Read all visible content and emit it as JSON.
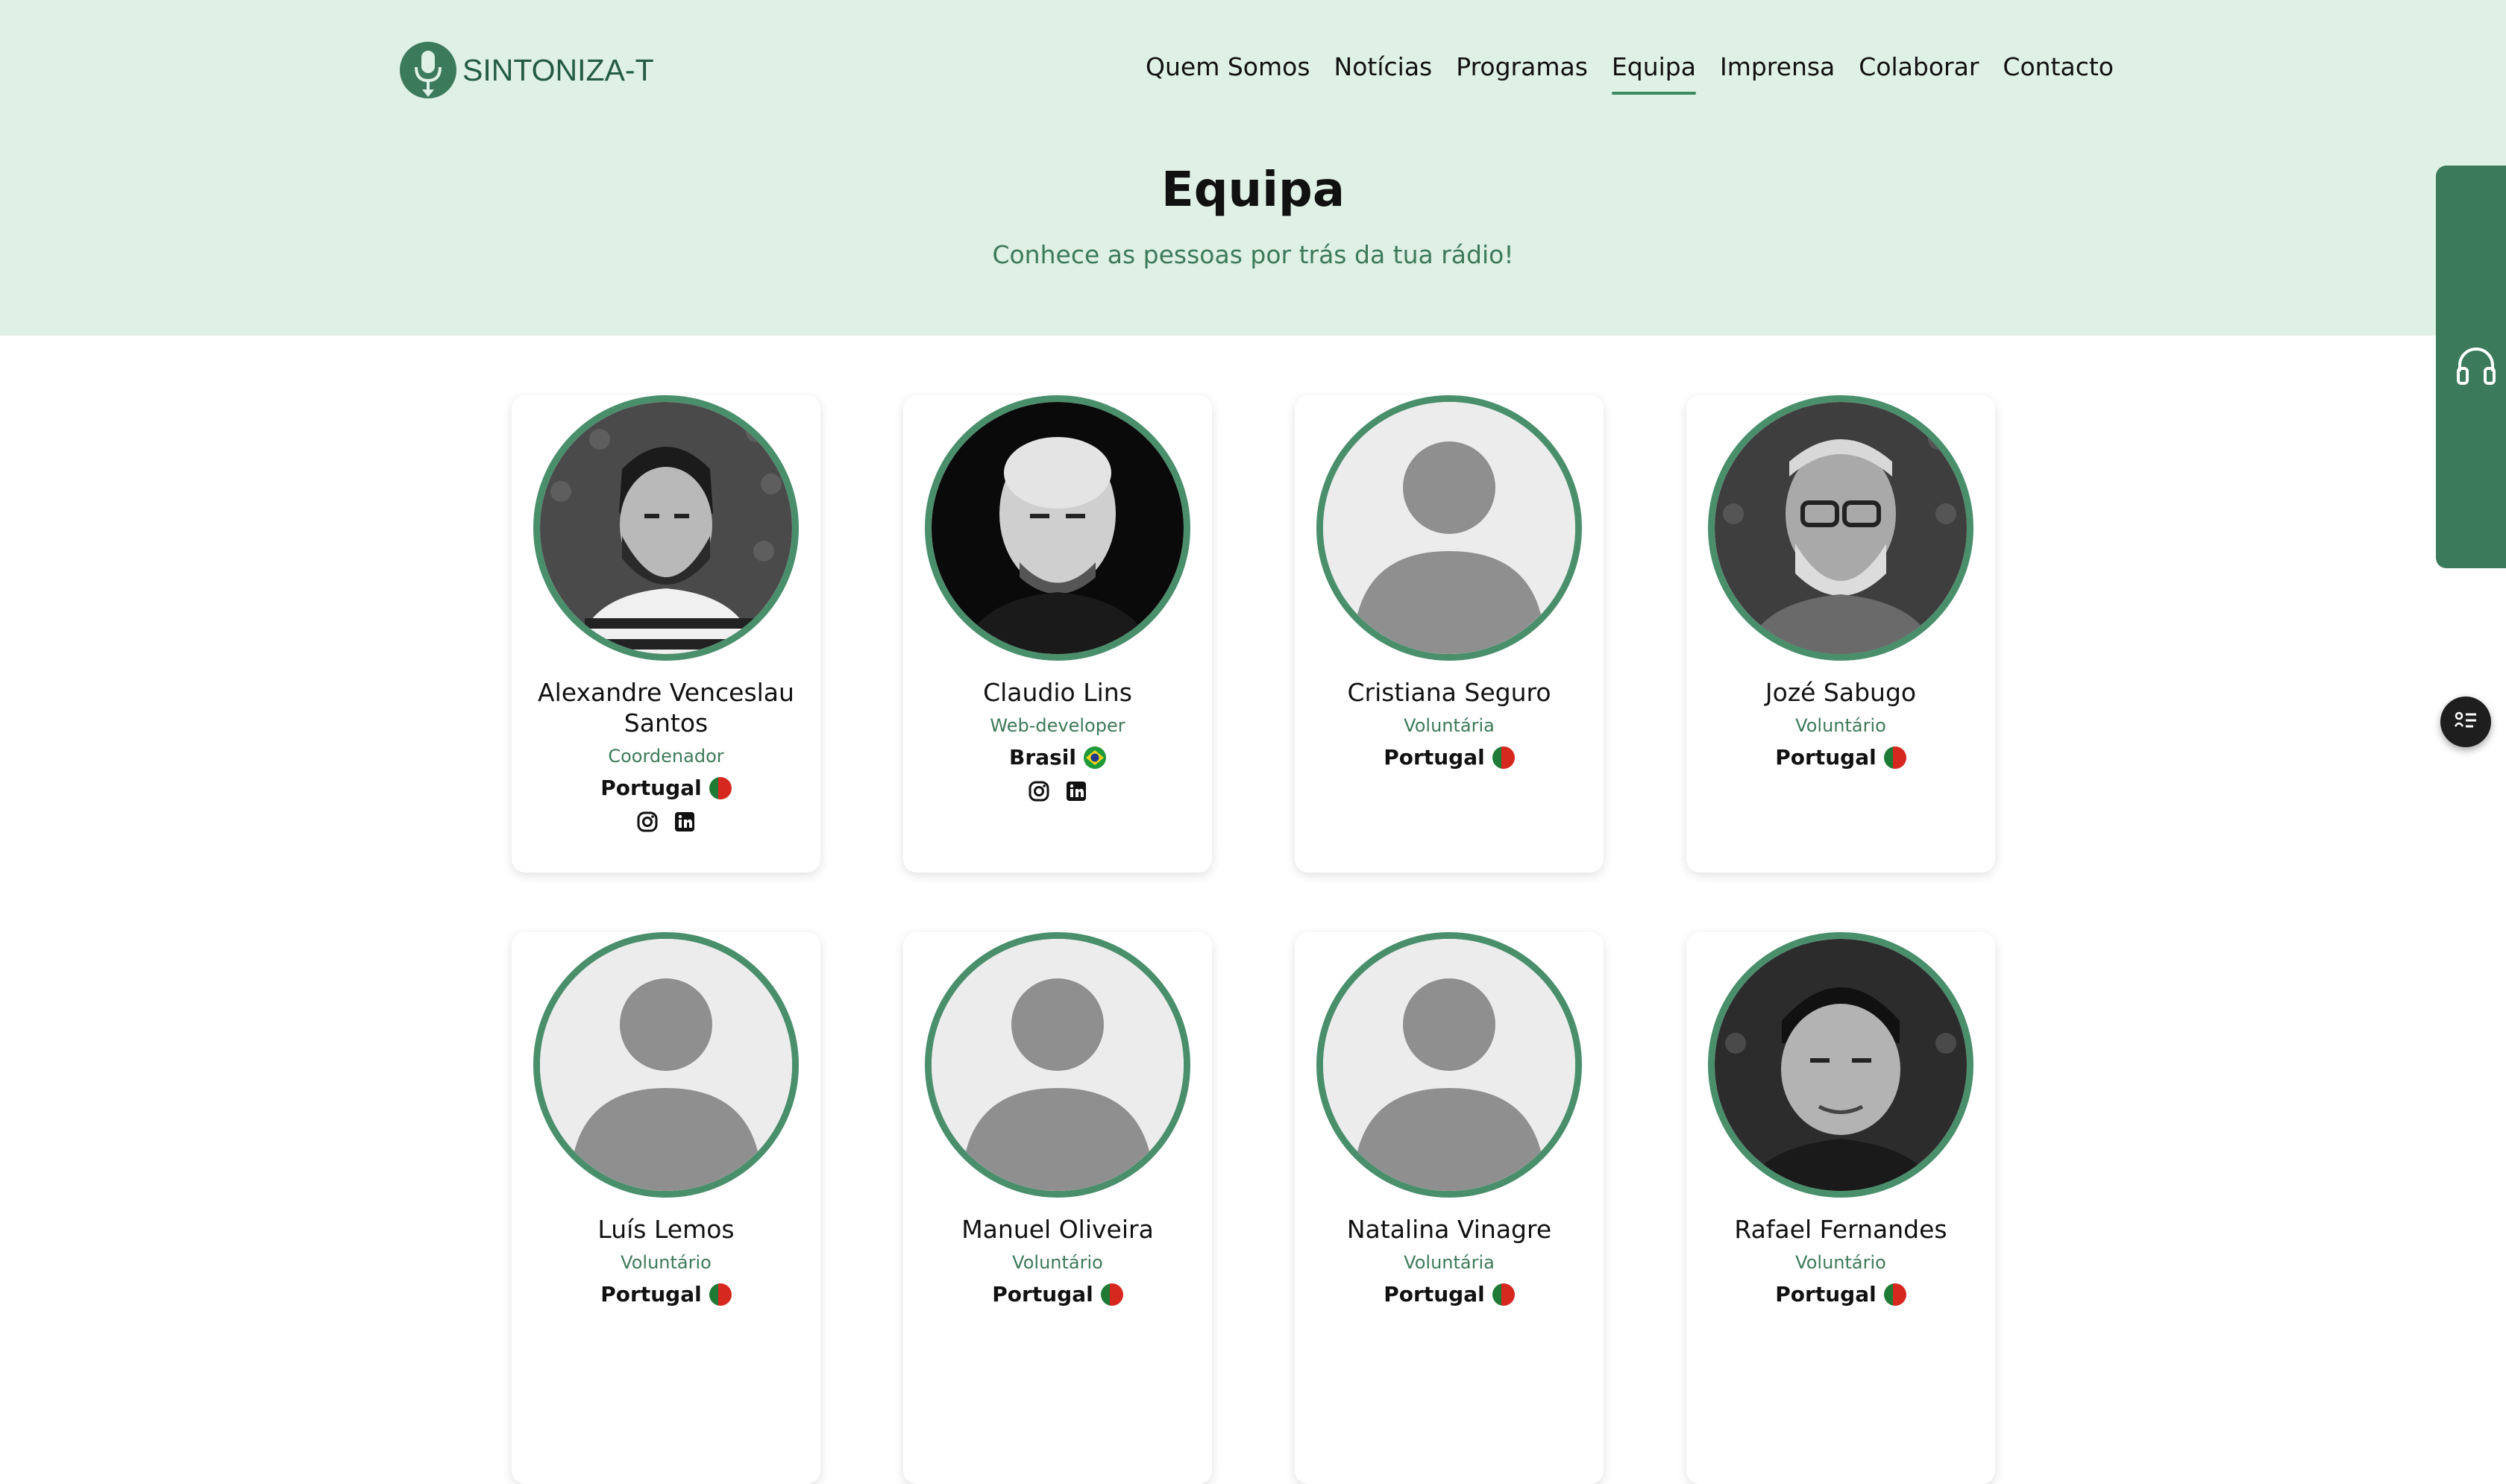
{
  "header": {
    "logo_text": "SINTONIZA-T",
    "nav": [
      {
        "label": "Quem Somos"
      },
      {
        "label": "Notícias"
      },
      {
        "label": "Programas"
      },
      {
        "label": "Equipa",
        "active": true
      },
      {
        "label": "Imprensa"
      },
      {
        "label": "Colaborar"
      },
      {
        "label": "Contacto"
      }
    ]
  },
  "hero": {
    "title": "Equipa",
    "subtitle": "Conhece as pessoas por trás da tua rádio!"
  },
  "team": [
    {
      "name": "Alexandre Venceslau Santos",
      "role": "Coordenador",
      "country": "Portugal",
      "avatar": "photo-man-beard",
      "socials": [
        "instagram-icon",
        "linkedin-icon"
      ]
    },
    {
      "name": "Claudio Lins",
      "role": "Web-developer",
      "country": "Brasil",
      "avatar": "photo-bald-man",
      "socials": [
        "instagram-icon",
        "linkedin-icon"
      ]
    },
    {
      "name": "Cristiana Seguro",
      "role": "Voluntária",
      "country": "Portugal",
      "avatar": "placeholder",
      "socials": []
    },
    {
      "name": "Jozé Sabugo",
      "role": "Voluntário",
      "country": "Portugal",
      "avatar": "photo-older-man-glasses",
      "socials": []
    },
    {
      "name": "Luís Lemos",
      "role": "Voluntário",
      "country": "Portugal",
      "avatar": "placeholder",
      "socials": []
    },
    {
      "name": "Manuel Oliveira",
      "role": "Voluntário",
      "country": "Portugal",
      "avatar": "placeholder",
      "socials": []
    },
    {
      "name": "Natalina Vinagre",
      "role": "Voluntária",
      "country": "Portugal",
      "avatar": "placeholder",
      "socials": []
    },
    {
      "name": "Rafael Fernandes",
      "role": "Voluntário",
      "country": "Portugal",
      "avatar": "photo-young-man",
      "socials": []
    }
  ],
  "widgets": {
    "player_icon": "headphones-icon",
    "accessibility_icon": "accessibility-menu-icon"
  },
  "colors": {
    "hero_bg": "#dff0e4",
    "accent": "#3d8a63",
    "avatar_border": "#4a8f6c",
    "side_player": "#3b7a5b"
  }
}
